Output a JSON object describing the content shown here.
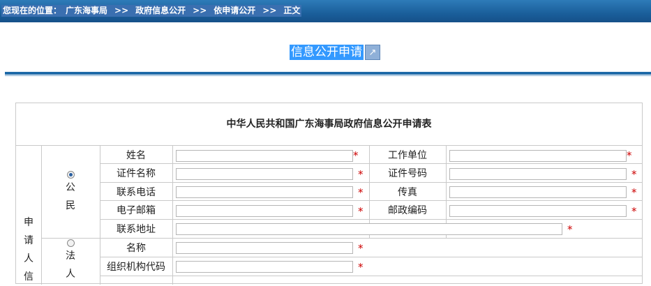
{
  "breadcrumb": {
    "prefix": "您现在的位置：",
    "items": [
      "广东海事局",
      "政府信息公开",
      "依申请公开",
      "正文"
    ],
    "separator": ">>"
  },
  "page_title": "信息公开申请",
  "form": {
    "title": "中华人民共和国广东海事局政府信息公开申请表",
    "applicant_section_label": "申请人信",
    "citizen": {
      "label": "公民",
      "selected": true,
      "fields": {
        "name": "姓名",
        "id_type": "证件名称",
        "phone": "联系电话",
        "email": "电子邮箱",
        "address": "联系地址",
        "work_unit": "工作单位",
        "id_number": "证件号码",
        "fax": "传真",
        "postcode": "邮政编码"
      }
    },
    "legal_person": {
      "label": "法人",
      "selected": false,
      "fields": {
        "name": "名称",
        "org_code": "组织机构代码"
      }
    },
    "required_mark": "*"
  }
}
